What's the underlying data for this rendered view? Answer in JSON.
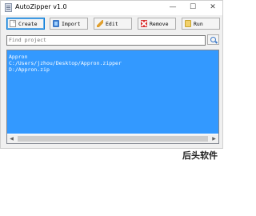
{
  "window": {
    "title": "AutoZipper v1.0",
    "controls": {
      "minimize": "—",
      "maximize": "☐",
      "close": "✕"
    }
  },
  "toolbar": {
    "create_label": "Create",
    "import_label": "Import",
    "edit_label": "Edit",
    "remove_label": "Remove",
    "run_label": "Run"
  },
  "search": {
    "placeholder": "Find project",
    "value": ""
  },
  "projects": [
    "Appron",
    "C:/Users/jzhou/Desktop/Appron.zipper",
    "D:/Appron.zip"
  ],
  "scrollbar": {
    "left_arrow": "◀",
    "right_arrow": "▶"
  },
  "background": {
    "text": "后头软件"
  },
  "colors": {
    "selection": "#3399ff",
    "accent_border": "#0078d7"
  }
}
